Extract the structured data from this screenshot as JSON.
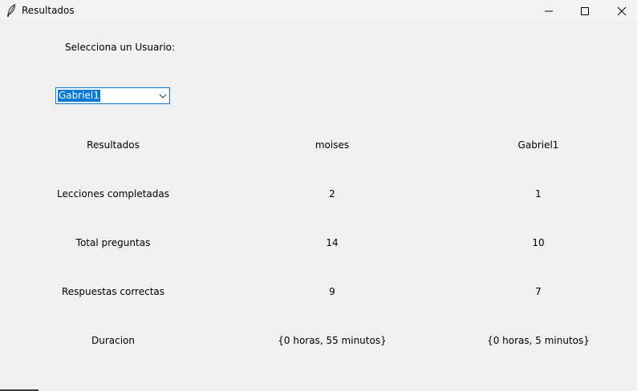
{
  "window": {
    "title": "Resultados"
  },
  "prompt_label": "Selecciona un Usuario:",
  "user_select": {
    "selected": "Gabriel1"
  },
  "table": {
    "header": [
      "Resultados",
      "moises",
      "Gabriel1"
    ],
    "rows": [
      [
        "Lecciones completadas",
        "2",
        "1"
      ],
      [
        "Total preguntas",
        "14",
        "10"
      ],
      [
        "Respuestas correctas",
        "9",
        "7"
      ],
      [
        "Duracion",
        "{0 horas, 55 minutos}",
        "{0 horas, 5 minutos}"
      ]
    ]
  },
  "icons": {
    "app": "feather-icon",
    "minimize": "minimize-icon",
    "maximize": "maximize-icon",
    "close": "close-icon",
    "dropdown": "chevron-down-icon"
  },
  "colors": {
    "background": "#f0f0f0",
    "selection": "#0078d7"
  }
}
